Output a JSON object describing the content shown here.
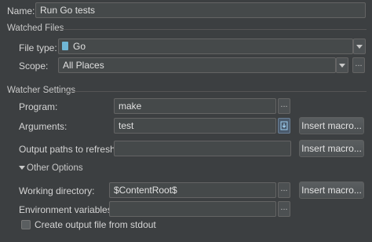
{
  "name": {
    "label": "Name:",
    "value": "Run Go tests"
  },
  "watched_files": {
    "section_title": "Watched Files",
    "file_type": {
      "label": "File type:",
      "value": "Go",
      "icon": "go-file-icon"
    },
    "scope": {
      "label": "Scope:",
      "value": "All Places",
      "more_label": "..."
    }
  },
  "watcher_settings": {
    "section_title": "Watcher Settings",
    "program": {
      "label": "Program:",
      "value": "make",
      "more_label": "..."
    },
    "arguments": {
      "label": "Arguments:",
      "value": "test",
      "insert_macro": "Insert macro..."
    },
    "output_paths": {
      "label": "Output paths to refresh:",
      "value": "",
      "insert_macro": "Insert macro..."
    }
  },
  "other_options": {
    "section_title": "Other Options",
    "working_directory": {
      "label": "Working directory:",
      "value": "$ContentRoot$",
      "more_label": "...",
      "insert_macro": "Insert macro..."
    },
    "environment_variables": {
      "label": "Environment variables:",
      "value": "",
      "more_label": "..."
    },
    "create_output_file": {
      "label": "Create output file from stdout",
      "checked": false
    }
  }
}
